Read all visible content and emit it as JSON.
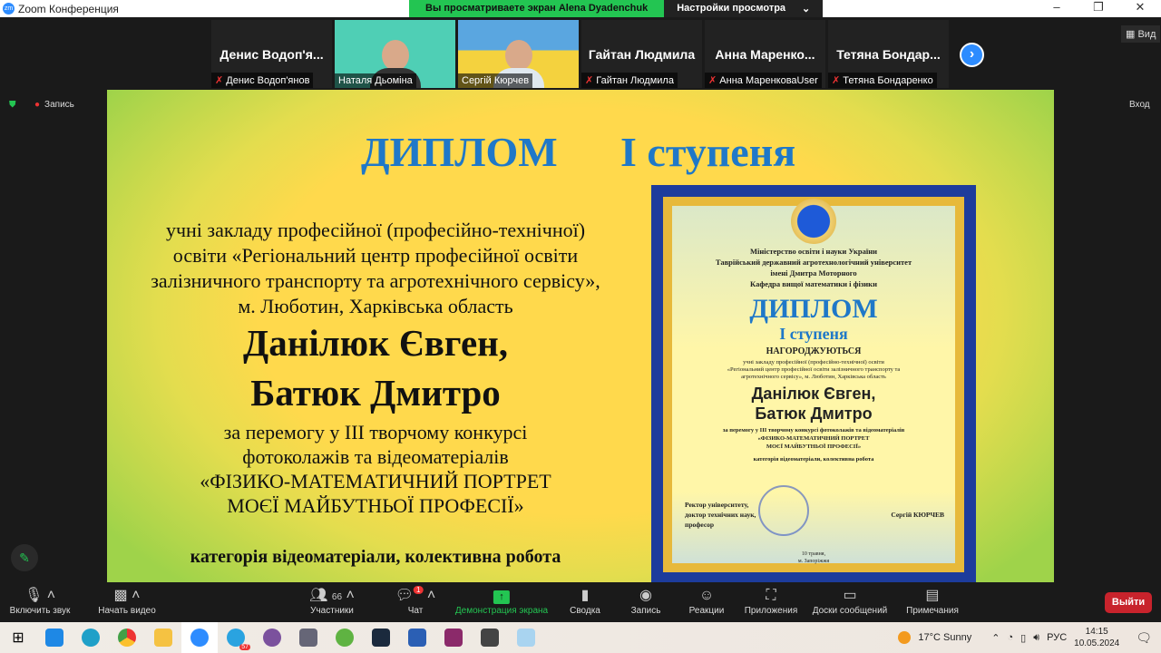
{
  "window": {
    "title": "Zoom Конференция",
    "share_banner": "Вы просматриваете экран Alena Dyadenchuk",
    "view_settings": "Настройки просмотра",
    "min": "–",
    "max": "❐",
    "close": "✕"
  },
  "participants": [
    {
      "big": "Денис Водоп'я...",
      "label": "Денис Водоп'янов",
      "muted": true
    },
    {
      "big": "",
      "label": "Наталя Дьоміна",
      "muted": false
    },
    {
      "big": "",
      "label": "Сергій Кюрчев",
      "muted": false
    },
    {
      "big": "Гайтан Людмила",
      "label": "Гайтан Людмила",
      "muted": true
    },
    {
      "big": "Анна Маренко...",
      "label": "Анна МаренковаUser",
      "muted": true
    },
    {
      "big": "Тетяна Бондар...",
      "label": "Тетяна Бондаренко",
      "muted": true
    }
  ],
  "view_label": "Вид",
  "record_label": "Запись",
  "enter_label": "Вход",
  "slide": {
    "title1": "ДИПЛОМ",
    "title2": "I ступеня",
    "lines": [
      "учні закладу професійної (професійно-технічної)",
      "освіти «Регіональний центр професійної освіти",
      "залізничного транспорту та агротехнічного сервісу»,",
      "м. Люботин, Харківська область"
    ],
    "name1": "Данілюк Євген,",
    "name2": "Батюк Дмитро",
    "lines2": [
      "за перемогу у ІІІ творчому конкурсі",
      "фотоколажів та відеоматеріалів",
      "«ФІЗИКО-МАТЕМАТИЧНИЙ ПОРТРЕТ",
      "МОЄЇ МАЙБУТНЬОЇ ПРОФЕСІЇ»"
    ],
    "category": "категорія відеоматеріали, колективна робота"
  },
  "diploma": {
    "header": [
      "Міністерство освіти і науки України",
      "Таврійський державний агротехнологічний університет",
      "імені Дмитра Моторного",
      "Кафедра вищої математики і фізики"
    ],
    "title": "ДИПЛОМ",
    "degree": "І ступеня",
    "awarded": "НАГОРОДЖУЮТЬСЯ",
    "text": [
      "учні закладу професійної (професійно-технічної) освіти",
      "«Регіональний центр професійної освіти залізничного транспорту та",
      "агротехнічного сервісу», м. Люботин, Харківська область"
    ],
    "name1": "Данілюк Євген,",
    "name2": "Батюк Дмитро",
    "text2": [
      "за перемогу у ІІІ творчому конкурсі фотоколажів та відеоматеріалів",
      "«ФІЗИКО-МАТЕМАТИЧНИЙ ПОРТРЕТ",
      "МОЄЇ МАЙБУТНЬОЇ ПРОФЕСІЇ»"
    ],
    "category": "категорія відеоматеріали, колективна робота",
    "signer_title": [
      "Ректор університету,",
      "доктор технічних наук,",
      "професор"
    ],
    "signer": "Сергій КЮРЧЕВ",
    "date": "10 травня,",
    "city": "м. Запоріжжя"
  },
  "toolbar": {
    "unmute": "Включить звук",
    "video": "Начать видео",
    "participants": "Участники",
    "participants_count": "66",
    "chat": "Чат",
    "chat_badge": "1",
    "share": "Демонстрация экрана",
    "summary": "Сводка",
    "record": "Запись",
    "reactions": "Реакции",
    "apps": "Приложения",
    "whiteboards": "Доски сообщений",
    "notes": "Примечания",
    "leave": "Выйти"
  },
  "taskbar": {
    "weather": "17°C  Sunny",
    "lang": "РУС",
    "time": "14:15",
    "date": "10.05.2024",
    "telegram_badge": "57"
  },
  "colors": {
    "accent": "#2d8cff",
    "share_green": "#23c552",
    "leave_red": "#c8232c",
    "diploma_blue": "#1f78c8"
  }
}
